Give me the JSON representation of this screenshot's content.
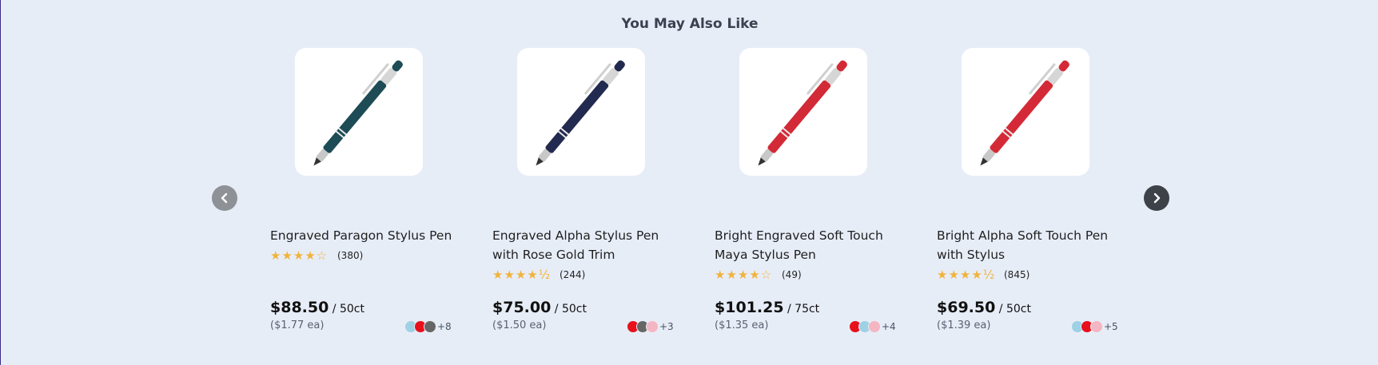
{
  "section": {
    "title": "You May Also Like"
  },
  "colors": {
    "background": "#e7edf7",
    "star": "#f0b33b"
  },
  "products": [
    {
      "name": "Engraved Paragon Stylus Pen",
      "stars": "★★★★☆",
      "reviews": "(380)",
      "price": "$88.50",
      "per": " / 50ct",
      "each": "($1.77 ea)",
      "swatches": [
        "#9ed1e4",
        "#e8101b",
        "#666666"
      ],
      "more": "+8",
      "pen_color": "#1d4b56"
    },
    {
      "name": "Engraved Alpha Stylus Pen with Rose Gold Trim",
      "stars": "★★★★½",
      "reviews": "(244)",
      "price": "$75.00",
      "per": " / 50ct",
      "each": "($1.50 ea)",
      "swatches": [
        "#e8101b",
        "#666666",
        "#f4b6c2"
      ],
      "more": "+3",
      "pen_color": "#232a4f"
    },
    {
      "name": "Bright Engraved Soft Touch Maya Stylus Pen",
      "stars": "★★★★☆",
      "reviews": "(49)",
      "price": "$101.25",
      "per": " / 75ct",
      "each": "($1.35 ea)",
      "swatches": [
        "#e8101b",
        "#9ed1e4",
        "#f4b6c2"
      ],
      "more": "+4",
      "pen_color": "#d22a36"
    },
    {
      "name": "Bright Alpha Soft Touch Pen with Stylus",
      "stars": "★★★★½",
      "reviews": "(845)",
      "price": "$69.50",
      "per": " / 50ct",
      "each": "($1.39 ea)",
      "swatches": [
        "#9ed1e4",
        "#e8101b",
        "#f4b6c2"
      ],
      "more": "+5",
      "pen_color": "#d42a37"
    }
  ]
}
